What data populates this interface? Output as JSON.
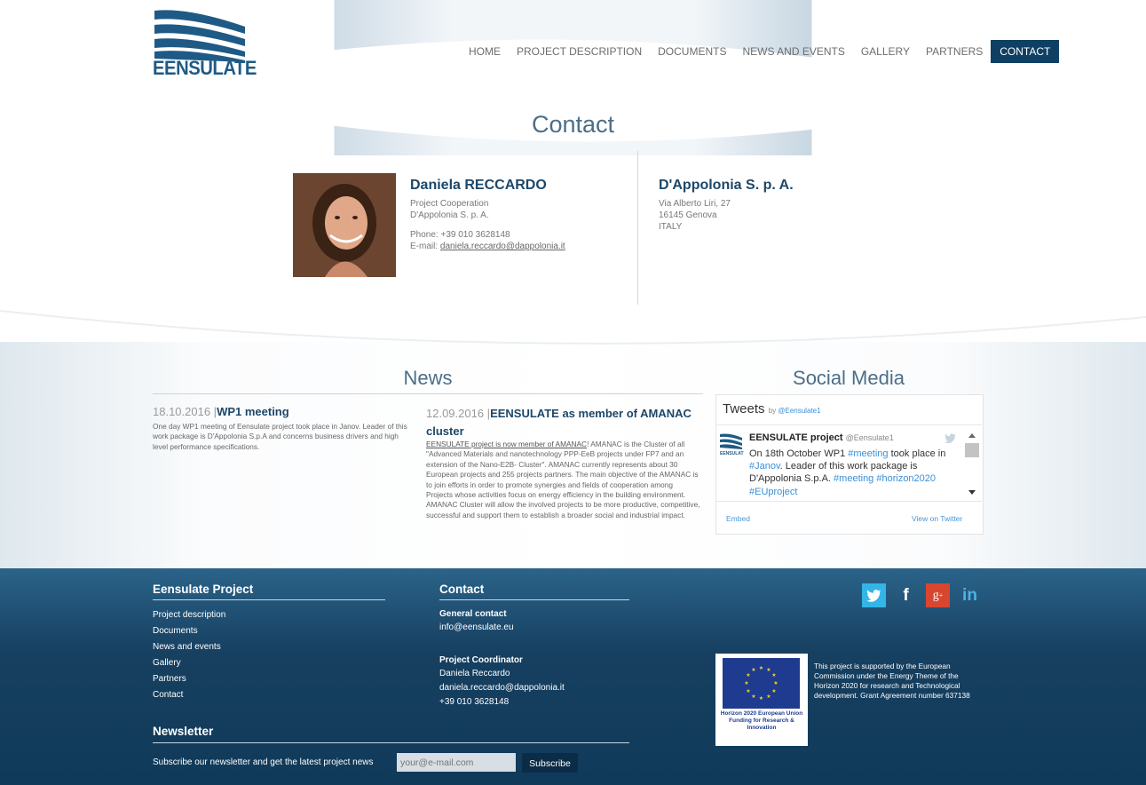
{
  "header": {
    "logo_text": "EENSULATE",
    "nav": [
      {
        "label": "HOME"
      },
      {
        "label": "PROJECT DESCRIPTION"
      },
      {
        "label": "DOCUMENTS"
      },
      {
        "label": "NEWS AND EVENTS"
      },
      {
        "label": "GALLERY"
      },
      {
        "label": "PARTNERS"
      },
      {
        "label": "CONTACT",
        "active": true
      }
    ]
  },
  "contact_section": {
    "title": "Contact",
    "person": {
      "name": "Daniela RECCARDO",
      "role": "Project Cooperation",
      "company": "D'Appolonia S. p. A.",
      "phone": "Phone: +39 010 3628148",
      "email_label": "E-mail: ",
      "email": "daniela.reccardo@dappolonia.it"
    },
    "company": {
      "name": "D'Appolonia S. p. A.",
      "address1": "Via Alberto Liri, 27",
      "address2": "16145 Genova",
      "country": "ITALY"
    }
  },
  "news": {
    "title": "News",
    "items": [
      {
        "date": "18.10.2016 |",
        "title": "WP1 meeting",
        "body": "One day WP1 meeting of Eensulate project took place in Janov. Leader of this work package is D'Appolonia S.p.A and concerns business drivers and high level performance specifications."
      },
      {
        "date": "12.09.2016 |",
        "title": "EENSULATE as member of AMANAC cluster",
        "link_text": "EENSULATE project is now member of AMANAC",
        "body": "! AMANAC is the Cluster of all \"Advanced Materials and nanotechnology PPP-EeB projects under FP7 and an extension of the Nano-E2B- Cluster\". AMANAC currently represents about 30 European projects and 255 projects partners. The main objective of the AMANAC is to join efforts in order to promote synergies and fields of cooperation among Projects whose activities focus on energy efficiency in the building environment. AMANAC Cluster will allow the involved projects to be more productive, competitive, successful and support them to establish a broader social and industrial impact."
      }
    ]
  },
  "social": {
    "title": "Social Media",
    "widget_title": "Tweets",
    "widget_by": "by ",
    "widget_handle": "@Eensulate1",
    "tweet": {
      "user": "EENSULATE project",
      "handle": "@Eensulate1",
      "t1": "On 18th October WP1 ",
      "h1": "#meeting",
      "t2": " took place in ",
      "h2": "#Janov",
      "t3": ". Leader of this work package is D'Appolonia S.p.A.  ",
      "h3": "#meeting #horizon2020 #EUproject"
    },
    "embed": "Embed",
    "view": "View on Twitter",
    "colors": {
      "link": "#3a8fd6"
    }
  },
  "footer": {
    "project_title": "Eensulate Project",
    "links": [
      "Project description",
      "Documents",
      "News and events",
      "Gallery",
      "Partners",
      "Contact"
    ],
    "contact_title": "Contact",
    "general_label": "General contact",
    "general_email": "info@eensulate.eu",
    "coord_label": "Project Coordinator",
    "coord_name": "Daniela Reccardo",
    "coord_email": "daniela.reccardo@dappolonia.it",
    "coord_phone": "+39 010 3628148",
    "newsletter_title": "Newsletter",
    "newsletter_text": "Subscribe our newsletter and get the latest project news",
    "newsletter_placeholder": "your@e-mail.com",
    "subscribe": "Subscribe",
    "social_icons": [
      "twitter-icon",
      "facebook-icon",
      "google-plus-icon",
      "linkedin-icon"
    ],
    "eu_caption": "Horizon 2020 European Union Funding for Research & Innovation",
    "eu_text": "This project is supported by the European Commission under the Energy Theme of the Horizon 2020 for research and Technological development. Grant Agreement number 637138",
    "colors": {
      "bg": "#163f60",
      "twitter": "#33b5e8",
      "facebook": "#2d5a96",
      "googleplus": "#d9462f",
      "linkedin": "#1c8fc6"
    }
  }
}
